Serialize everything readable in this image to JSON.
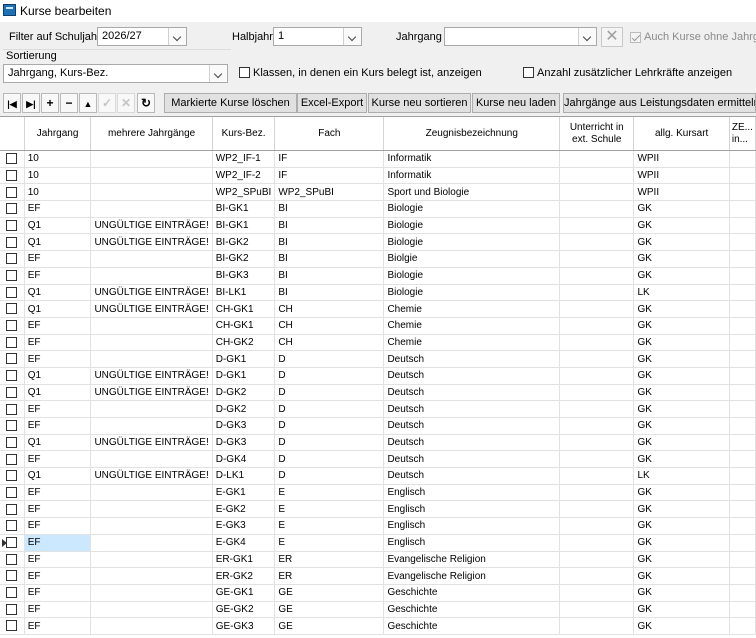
{
  "window": {
    "title": "Kurse bearbeiten"
  },
  "filters": {
    "schuljahr_label": "Filter auf Schuljahr",
    "schuljahr_value": "2026/27",
    "halbjahr_label": "Halbjahr",
    "halbjahr_value": "1",
    "jahrgang_label": "Jahrgang",
    "jahrgang_value": "",
    "ohne_jahrgang_label": "Auch Kurse ohne Jahrgang",
    "sortierung_label": "Sortierung",
    "sortierung_value": "Jahrgang, Kurs-Bez.",
    "klassen_label": "Klassen, in denen ein Kurs belegt ist, anzeigen",
    "lehrkraefte_label": "Anzahl zusätzlicher Lehrkräfte anzeigen"
  },
  "toolbar": {
    "first_icon": "first-record-icon",
    "last_icon": "last-record-icon",
    "add_icon": "plus-icon",
    "delete_icon": "minus-icon",
    "up_icon": "up-arrow-icon",
    "confirm_icon": "check-icon",
    "cancel_icon": "x-icon",
    "refresh_icon": "refresh-icon",
    "buttons": [
      "Markierte Kurse löschen",
      "Excel-Export",
      "Kurse neu sortieren",
      "Kurse neu laden",
      "Jahrgänge aus Leistungsdaten ermitteln"
    ]
  },
  "grid": {
    "columns": [
      "Jahrgang",
      "mehrere Jahrgänge",
      "Kurs-Bez.",
      "Fach",
      "Zeugnisbezeichnung",
      "Unterricht in ext. Schule",
      "allg. Kursart",
      "ZE... in..."
    ],
    "selected_row": 23,
    "rows": [
      [
        "10",
        "",
        "WP2_IF-1",
        "IF",
        "Informatik",
        "",
        "WPII"
      ],
      [
        "10",
        "",
        "WP2_IF-2",
        "IF",
        "Informatik",
        "",
        "WPII"
      ],
      [
        "10",
        "",
        "WP2_SPuBI",
        "WP2_SPuBI",
        "Sport und Biologie",
        "",
        "WPII"
      ],
      [
        "EF",
        "",
        "BI-GK1",
        "BI",
        "Biologie",
        "",
        "GK"
      ],
      [
        "Q1",
        "UNGÜLTIGE EINTRÄGE!",
        "BI-GK1",
        "BI",
        "Biologie",
        "",
        "GK"
      ],
      [
        "Q1",
        "UNGÜLTIGE EINTRÄGE!",
        "BI-GK2",
        "BI",
        "Biologie",
        "",
        "GK"
      ],
      [
        "EF",
        "",
        "BI-GK2",
        "BI",
        "Biolgie",
        "",
        "GK"
      ],
      [
        "EF",
        "",
        "BI-GK3",
        "BI",
        "Biologie",
        "",
        "GK"
      ],
      [
        "Q1",
        "UNGÜLTIGE EINTRÄGE!",
        "BI-LK1",
        "BI",
        "Biologie",
        "",
        "LK"
      ],
      [
        "Q1",
        "UNGÜLTIGE EINTRÄGE!",
        "CH-GK1",
        "CH",
        "Chemie",
        "",
        "GK"
      ],
      [
        "EF",
        "",
        "CH-GK1",
        "CH",
        "Chemie",
        "",
        "GK"
      ],
      [
        "EF",
        "",
        "CH-GK2",
        "CH",
        "Chemie",
        "",
        "GK"
      ],
      [
        "EF",
        "",
        "D-GK1",
        "D",
        "Deutsch",
        "",
        "GK"
      ],
      [
        "Q1",
        "UNGÜLTIGE EINTRÄGE!",
        "D-GK1",
        "D",
        "Deutsch",
        "",
        "GK"
      ],
      [
        "Q1",
        "UNGÜLTIGE EINTRÄGE!",
        "D-GK2",
        "D",
        "Deutsch",
        "",
        "GK"
      ],
      [
        "EF",
        "",
        "D-GK2",
        "D",
        "Deutsch",
        "",
        "GK"
      ],
      [
        "EF",
        "",
        "D-GK3",
        "D",
        "Deutsch",
        "",
        "GK"
      ],
      [
        "Q1",
        "UNGÜLTIGE EINTRÄGE!",
        "D-GK3",
        "D",
        "Deutsch",
        "",
        "GK"
      ],
      [
        "EF",
        "",
        "D-GK4",
        "D",
        "Deutsch",
        "",
        "GK"
      ],
      [
        "Q1",
        "UNGÜLTIGE EINTRÄGE!",
        "D-LK1",
        "D",
        "Deutsch",
        "",
        "LK"
      ],
      [
        "EF",
        "",
        "E-GK1",
        "E",
        "Englisch",
        "",
        "GK"
      ],
      [
        "EF",
        "",
        "E-GK2",
        "E",
        "Englisch",
        "",
        "GK"
      ],
      [
        "EF",
        "",
        "E-GK3",
        "E",
        "Englisch",
        "",
        "GK"
      ],
      [
        "EF",
        "",
        "E-GK4",
        "E",
        "Englisch",
        "",
        "GK"
      ],
      [
        "EF",
        "",
        "ER-GK1",
        "ER",
        "Evangelische Religion",
        "",
        "GK"
      ],
      [
        "EF",
        "",
        "ER-GK2",
        "ER",
        "Evangelische Religion",
        "",
        "GK"
      ],
      [
        "EF",
        "",
        "GE-GK1",
        "GE",
        "Geschichte",
        "",
        "GK"
      ],
      [
        "EF",
        "",
        "GE-GK2",
        "GE",
        "Geschichte",
        "",
        "GK"
      ],
      [
        "EF",
        "",
        "GE-GK3",
        "GE",
        "Geschichte",
        "",
        "GK"
      ]
    ]
  }
}
